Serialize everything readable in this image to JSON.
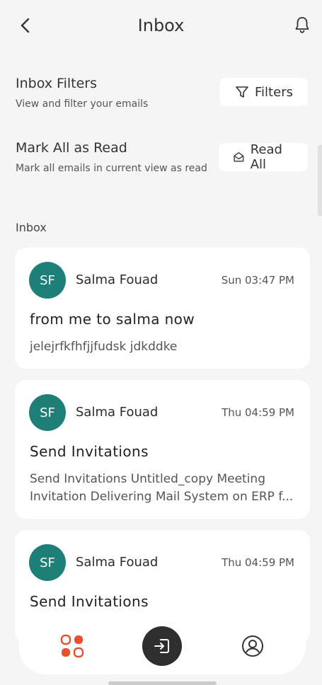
{
  "header": {
    "title": "Inbox"
  },
  "filters": {
    "title": "Inbox Filters",
    "subtitle": "View and filter your emails",
    "button_label": "Filters"
  },
  "mark_read": {
    "title": "Mark All as Read",
    "subtitle": "Mark all emails in current view as read",
    "button_label": "Read All"
  },
  "section_label": "Inbox",
  "emails": [
    {
      "initials": "SF",
      "sender": "Salma Fouad",
      "time": "Sun 03:47 PM",
      "subject": "from me to salma now",
      "preview": "jelejrfkfhfjjfudsk jdkddke"
    },
    {
      "initials": "SF",
      "sender": "Salma Fouad",
      "time": "Thu 04:59 PM",
      "subject": "Send Invitations",
      "preview": "Send Invitations Untitled_copy Meeting Invitation Delivering Mail System on ERP f..."
    },
    {
      "initials": "SF",
      "sender": "Salma Fouad",
      "time": "Thu 04:59 PM",
      "subject": "Send Invitations",
      "preview": ""
    }
  ],
  "icons": {
    "back": "chevron-left-icon",
    "bell": "bell-icon",
    "filter": "filter-icon",
    "envelope": "envelope-open-icon",
    "dashboard": "grid-icon",
    "login": "login-icon",
    "profile": "user-circle-icon"
  },
  "colors": {
    "avatar": "#1e7f78",
    "accent": "#e8502e",
    "center_nav": "#2f2f2f"
  }
}
